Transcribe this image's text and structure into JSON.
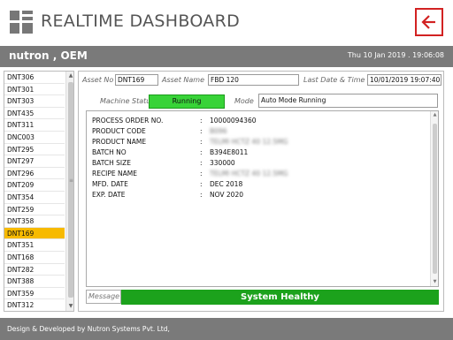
{
  "header": {
    "title": "REALTIME DASHBOARD",
    "logo_icon": "grid-logo-icon",
    "back_icon": "arrow-left-icon",
    "back_color": "#d22222"
  },
  "infobar": {
    "company": "nutron , OEM",
    "datetime": "Thu 10 Jan 2019 . 19:06:08"
  },
  "sidebar": {
    "items": [
      {
        "label": "DNT306"
      },
      {
        "label": "DNT301"
      },
      {
        "label": "DNT303"
      },
      {
        "label": "DNT435"
      },
      {
        "label": "DNT311"
      },
      {
        "label": "DNC003"
      },
      {
        "label": "DNT295"
      },
      {
        "label": "DNT297"
      },
      {
        "label": "DNT296"
      },
      {
        "label": "DNT209"
      },
      {
        "label": "DNT354"
      },
      {
        "label": "DNT259"
      },
      {
        "label": "DNT358"
      },
      {
        "label": "DNT169"
      },
      {
        "label": "DNT351"
      },
      {
        "label": "DNT168"
      },
      {
        "label": "DNT282"
      },
      {
        "label": "DNT388"
      },
      {
        "label": "DNT359"
      },
      {
        "label": "DNT312"
      }
    ],
    "selected_index": 13,
    "selected_color": "#f7ba00"
  },
  "asset": {
    "asset_no_label": "Asset No",
    "asset_no": "DNT169",
    "asset_name_label": "Asset Name",
    "asset_name": "FBD 120",
    "last_date_label": "Last Date & Time",
    "last_date": "10/01/2019 19:07:40",
    "machine_status_label": "Machine Status",
    "machine_status": "Running",
    "machine_status_color": "#38d338",
    "mode_label": "Mode",
    "mode": "Auto Mode Running"
  },
  "details": {
    "rows": [
      {
        "key": "PROCESS ORDER NO.",
        "value": "10000094360",
        "blurred": false
      },
      {
        "key": "PRODUCT CODE",
        "value": "B096",
        "blurred": true
      },
      {
        "key": "PRODUCT NAME",
        "value": "TELMI HCTZ 40 12.5MG",
        "blurred": true
      },
      {
        "key": "BATCH NO",
        "value": "B394E8011",
        "blurred": false
      },
      {
        "key": "BATCH SIZE",
        "value": "330000",
        "blurred": false
      },
      {
        "key": "RECIPE NAME",
        "value": "TELMI HCTZ 40 12.5MG",
        "blurred": true
      },
      {
        "key": "MFD. DATE",
        "value": "DEC 2018",
        "blurred": false
      },
      {
        "key": "EXP. DATE",
        "value": "NOV 2020",
        "blurred": false
      }
    ]
  },
  "message": {
    "label": "Message",
    "text": "System Healthy",
    "color": "#1ca21c"
  },
  "footer": {
    "text": "Design & Developed by Nutron Systems Pvt. Ltd,"
  }
}
